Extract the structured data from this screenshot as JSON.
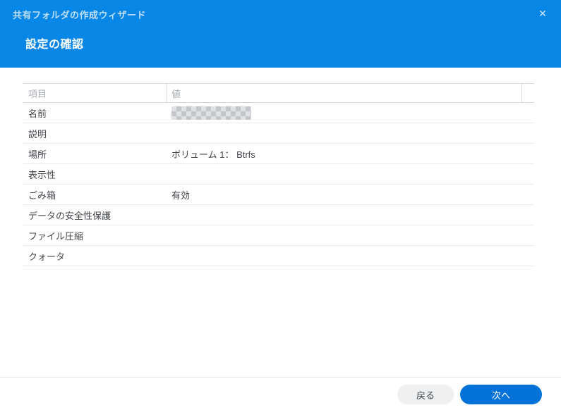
{
  "window": {
    "title": "共有フォルダの作成ウィザード",
    "close_glyph": "✕"
  },
  "header": {
    "title": "設定の確認"
  },
  "table": {
    "columns": [
      "項目",
      "値"
    ],
    "rows": [
      {
        "label": "名前",
        "value": "",
        "redacted": true
      },
      {
        "label": "説明",
        "value": "",
        "redacted": false
      },
      {
        "label": "場所",
        "value": "ボリューム 1： Btrfs",
        "redacted": false
      },
      {
        "label": "表示性",
        "value": "",
        "redacted": false
      },
      {
        "label": "ごみ箱",
        "value": "有効",
        "redacted": false
      },
      {
        "label": "データの安全性保護",
        "value": "",
        "redacted": false
      },
      {
        "label": "ファイル圧縮",
        "value": "",
        "redacted": false
      },
      {
        "label": "クォータ",
        "value": "",
        "redacted": false
      }
    ]
  },
  "footer": {
    "back_label": "戻る",
    "next_label": "次へ"
  },
  "colors": {
    "header_blue": "#0987e6",
    "primary_button_blue": "#0272d9",
    "header_title_text": "#bfdff7",
    "table_header_text": "#a9aeb4",
    "body_text": "#42464b"
  }
}
